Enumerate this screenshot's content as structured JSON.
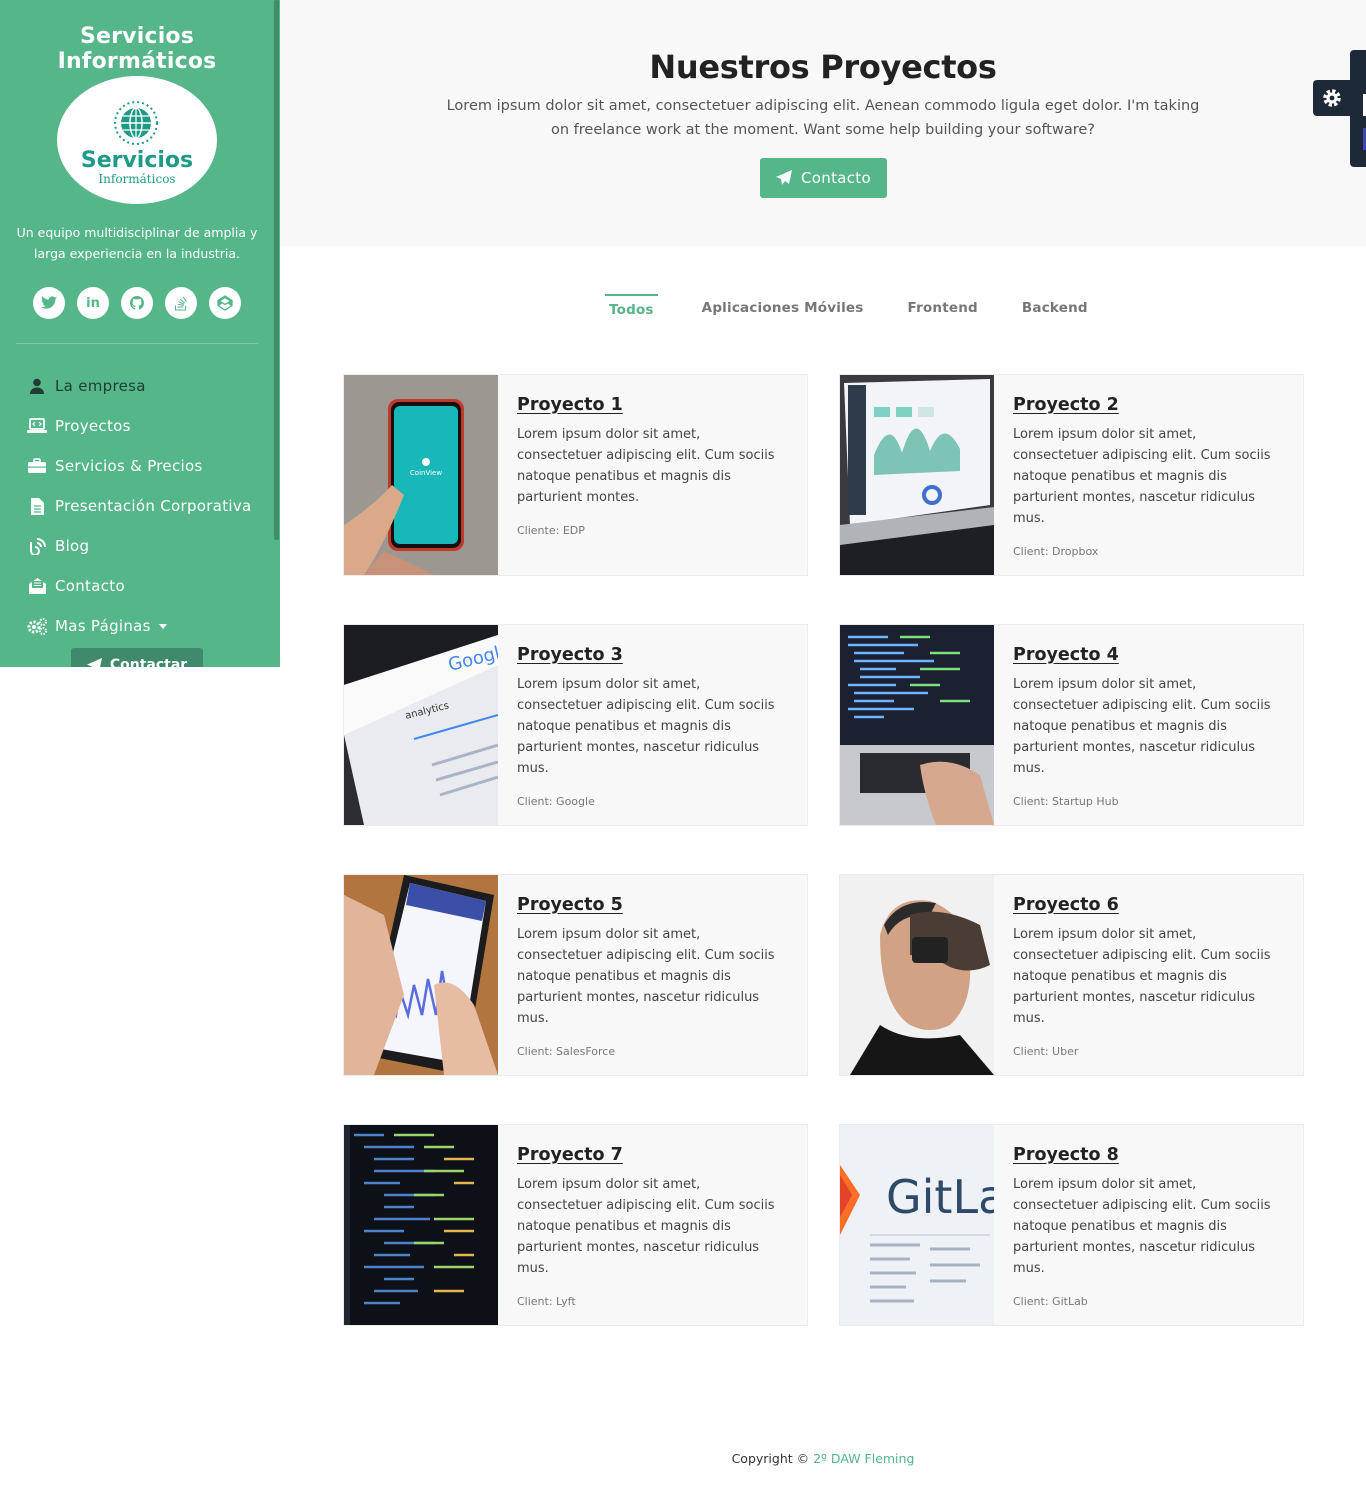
{
  "sidebar": {
    "brand": "Servicios Informáticos",
    "logo_name": "Servicios",
    "logo_sub": "Informáticos",
    "tagline": "Un equipo multidisciplinar de amplia y larga experiencia en la industria.",
    "socials": [
      {
        "icon": "twitter-icon",
        "glyph": "🐦"
      },
      {
        "icon": "linkedin-icon",
        "glyph": "in"
      },
      {
        "icon": "github-icon",
        "glyph": "◎"
      },
      {
        "icon": "stackoverflow-icon",
        "glyph": "≡"
      },
      {
        "icon": "codepen-icon",
        "glyph": "◇"
      }
    ],
    "nav": [
      {
        "label": "La empresa",
        "icon": "user-icon"
      },
      {
        "label": "Proyectos",
        "icon": "laptop-code-icon"
      },
      {
        "label": "Servicios & Precios",
        "icon": "briefcase-icon"
      },
      {
        "label": "Presentación Corporativa",
        "icon": "file-icon"
      },
      {
        "label": "Blog",
        "icon": "blog-icon"
      },
      {
        "label": "Contacto",
        "icon": "envelope-open-icon"
      },
      {
        "label": "Mas Páginas",
        "icon": "cogs-icon"
      }
    ],
    "cta_label": "Contactar"
  },
  "hero": {
    "title": "Nuestros Proyectos",
    "text": "Lorem ipsum dolor sit amet, consectetuer adipiscing elit. Aenean commodo ligula eget dolor. I'm taking on freelance work at the moment. Want some help building your software?",
    "button": "Contacto"
  },
  "filters": [
    "Todos",
    "Aplicaciones Móviles",
    "Frontend",
    "Backend"
  ],
  "projects": [
    {
      "title": "Proyecto 1",
      "text": "Lorem ipsum dolor sit amet, consectetuer adipiscing elit. Cum sociis natoque penatibus et magnis dis parturient montes.",
      "client": "Cliente: EDP",
      "image": "phone-app-image",
      "app_label": "CoinView"
    },
    {
      "title": "Proyecto 2",
      "text": "Lorem ipsum dolor sit amet, consectetuer adipiscing elit. Cum sociis natoque penatibus et magnis dis parturient montes, nascetur ridiculus mus.",
      "client": "Client: Dropbox",
      "image": "laptop-dashboard-image"
    },
    {
      "title": "Proyecto 3",
      "text": "Lorem ipsum dolor sit amet, consectetuer adipiscing elit. Cum sociis natoque penatibus et magnis dis parturient montes, nascetur ridiculus mus.",
      "client": "Client: Google",
      "image": "google-search-image",
      "brand_label": "Google",
      "search_label": "analytics"
    },
    {
      "title": "Proyecto 4",
      "text": "Lorem ipsum dolor sit amet, consectetuer adipiscing elit. Cum sociis natoque penatibus et magnis dis parturient montes, nascetur ridiculus mus.",
      "client": "Client: Startup Hub",
      "image": "laptop-coding-image"
    },
    {
      "title": "Proyecto 5",
      "text": "Lorem ipsum dolor sit amet, consectetuer adipiscing elit. Cum sociis natoque penatibus et magnis dis parturient montes, nascetur ridiculus mus.",
      "client": "Client: SalesForce",
      "image": "phone-chart-image"
    },
    {
      "title": "Proyecto 6",
      "text": "Lorem ipsum dolor sit amet, consectetuer adipiscing elit. Cum sociis natoque penatibus et magnis dis parturient montes, nascetur ridiculus mus.",
      "client": "Client: Uber",
      "image": "vr-headset-image"
    },
    {
      "title": "Proyecto 7",
      "text": "Lorem ipsum dolor sit amet, consectetuer adipiscing elit. Cum sociis natoque penatibus et magnis dis parturient montes, nascetur ridiculus mus.",
      "client": "Client: Lyft",
      "image": "code-screen-image"
    },
    {
      "title": "Proyecto 8",
      "text": "Lorem ipsum dolor sit amet, consectetuer adipiscing elit. Cum sociis natoque penatibus et magnis dis parturient montes, nascetur ridiculus mus.",
      "client": "Client: GitLab",
      "image": "gitlab-screen-image",
      "brand_label": "GitLa"
    }
  ],
  "footer": {
    "prefix": "Copyright © ",
    "link": "2º DAW Fleming"
  },
  "colors": {
    "accent": "#54b689",
    "panel": "#1d2936"
  }
}
